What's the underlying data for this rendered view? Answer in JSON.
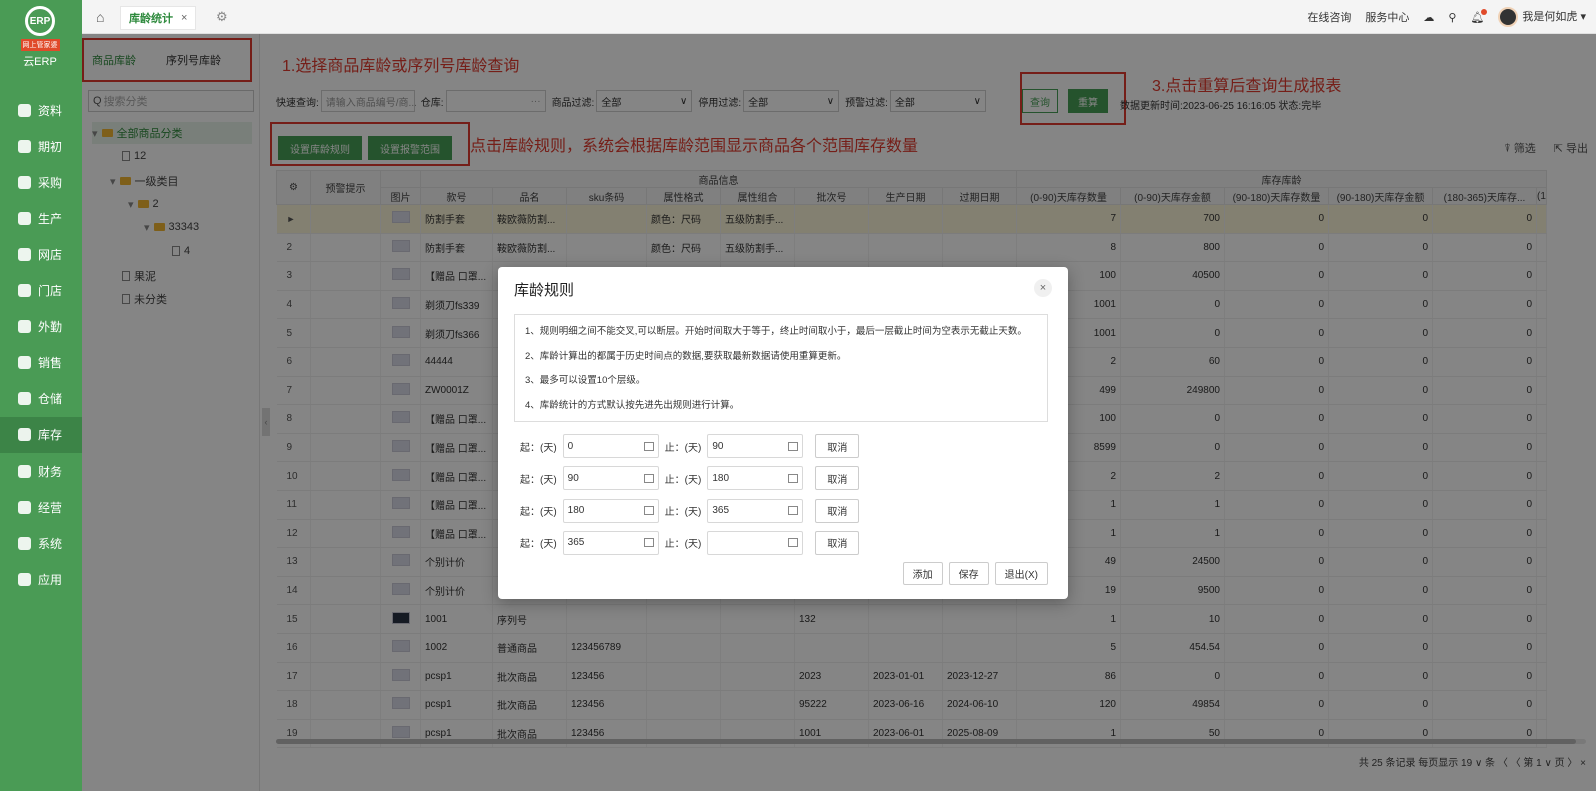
{
  "sidebar": {
    "logo": {
      "tag": "网上管家婆",
      "name": "云ERP"
    },
    "items": [
      {
        "label": "资料",
        "icon": "folder-icon"
      },
      {
        "label": "期初",
        "icon": "clock-icon"
      },
      {
        "label": "采购",
        "icon": "cart-icon"
      },
      {
        "label": "生产",
        "icon": "factory-icon"
      },
      {
        "label": "网店",
        "icon": "shop-icon"
      },
      {
        "label": "门店",
        "icon": "store-icon"
      },
      {
        "label": "外勤",
        "icon": "location-icon"
      },
      {
        "label": "销售",
        "icon": "sales-icon"
      },
      {
        "label": "仓储",
        "icon": "warehouse-icon"
      },
      {
        "label": "库存",
        "icon": "inventory-icon"
      },
      {
        "label": "财务",
        "icon": "finance-icon"
      },
      {
        "label": "经营",
        "icon": "chart-icon"
      },
      {
        "label": "系统",
        "icon": "gear-icon"
      },
      {
        "label": "应用",
        "icon": "apps-icon"
      }
    ]
  },
  "topbar": {
    "tab_label": "库龄统计",
    "tab_close": "×",
    "right": {
      "consult": "在线咨询",
      "service": "服务中心",
      "user": "我是何如虎"
    }
  },
  "tree": {
    "mode_tabs": [
      "商品库龄",
      "序列号库龄"
    ],
    "search_placeholder": "搜索分类",
    "nodes": [
      "全部商品分类",
      "12",
      "一级类目",
      "2",
      "33343",
      "4",
      "果泥",
      "未分类"
    ]
  },
  "annotations": {
    "step1": "1.选择商品库龄或序列号库龄查询",
    "step2": "点击库龄规则，系统会根据库龄范围显示商品各个范围库存数量",
    "step3": "3.点击重算后查询生成报表"
  },
  "filters": {
    "quick_label": "快速查询:",
    "quick_placeholder": "请输入商品编号/商...",
    "warehouse_label": "仓库:",
    "goods_filter_label": "商品过滤:",
    "goods_filter_value": "全部",
    "disabled_filter_label": "停用过滤:",
    "disabled_filter_value": "全部",
    "warn_filter_label": "预警过滤:",
    "warn_filter_value": "全部",
    "query_btn": "查询",
    "recalc_btn": "重算",
    "status_text": "数据更新时间:2023-06-25 16:16:05 状态:完毕"
  },
  "toolbar": {
    "rule_btn": "设置库龄规则",
    "warn_btn": "设置报警范围",
    "filter_label": "筛选",
    "export_label": "导出"
  },
  "grid": {
    "group_headers": {
      "goods": "商品信息",
      "age": "库存库龄"
    },
    "columns": [
      "预警提示",
      "图片",
      "款号",
      "品名",
      "sku条码",
      "属性格式",
      "属性组合",
      "批次号",
      "生产日期",
      "过期日期",
      "(0-90)天库存数量",
      "(0-90)天库存金额",
      "(90-180)天库存数量",
      "(90-180)天库存金额",
      "(180-365)天库存...",
      "(1"
    ],
    "rows": [
      {
        "n": "►",
        "code": "防割手套",
        "name": "鞍欧薇防割...",
        "sku": "",
        "fmt": "颜色：尺码",
        "combo": "五级防割手...",
        "batch": "",
        "prod": "",
        "exp": "",
        "q1": "7",
        "a1": "700",
        "q2": "0",
        "a2": "0",
        "q3": "0"
      },
      {
        "n": "2",
        "code": "防割手套",
        "name": "鞍欧薇防割...",
        "sku": "",
        "fmt": "颜色：尺码",
        "combo": "五级防割手...",
        "batch": "",
        "prod": "",
        "exp": "",
        "q1": "8",
        "a1": "800",
        "q2": "0",
        "a2": "0",
        "q3": "0"
      },
      {
        "n": "3",
        "code": "【赠品 口罩...",
        "name": "",
        "sku": "",
        "fmt": "",
        "combo": "",
        "batch": "",
        "prod": "",
        "exp": "",
        "q1": "100",
        "a1": "40500",
        "q2": "0",
        "a2": "0",
        "q3": "0"
      },
      {
        "n": "4",
        "code": "剃须刀fs339",
        "name": "",
        "sku": "",
        "fmt": "",
        "combo": "",
        "batch": "",
        "prod": "",
        "exp": "",
        "q1": "1001",
        "a1": "0",
        "q2": "0",
        "a2": "0",
        "q3": "0"
      },
      {
        "n": "5",
        "code": "剃须刀fs366",
        "name": "",
        "sku": "",
        "fmt": "",
        "combo": "",
        "batch": "",
        "prod": "",
        "exp": "",
        "q1": "1001",
        "a1": "0",
        "q2": "0",
        "a2": "0",
        "q3": "0"
      },
      {
        "n": "6",
        "code": "44444",
        "name": "",
        "sku": "",
        "fmt": "",
        "combo": "",
        "batch": "",
        "prod": "",
        "exp": "",
        "q1": "2",
        "a1": "60",
        "q2": "0",
        "a2": "0",
        "q3": "0"
      },
      {
        "n": "7",
        "code": "ZW0001Z",
        "name": "",
        "sku": "",
        "fmt": "",
        "combo": "",
        "batch": "",
        "prod": "",
        "exp": "",
        "q1": "499",
        "a1": "249800",
        "q2": "0",
        "a2": "0",
        "q3": "0"
      },
      {
        "n": "8",
        "code": "【赠品 口罩...",
        "name": "",
        "sku": "",
        "fmt": "",
        "combo": "",
        "batch": "",
        "prod": "",
        "exp": "",
        "q1": "100",
        "a1": "0",
        "q2": "0",
        "a2": "0",
        "q3": "0"
      },
      {
        "n": "9",
        "code": "【赠品 口罩...",
        "name": "",
        "sku": "",
        "fmt": "",
        "combo": "",
        "batch": "",
        "prod": "",
        "exp": "",
        "q1": "8599",
        "a1": "0",
        "q2": "0",
        "a2": "0",
        "q3": "0"
      },
      {
        "n": "10",
        "code": "【赠品 口罩...",
        "name": "",
        "sku": "",
        "fmt": "",
        "combo": "",
        "batch": "",
        "prod": "",
        "exp": "",
        "q1": "2",
        "a1": "2",
        "q2": "0",
        "a2": "0",
        "q3": "0"
      },
      {
        "n": "11",
        "code": "【赠品 口罩...",
        "name": "",
        "sku": "",
        "fmt": "",
        "combo": "",
        "batch": "",
        "prod": "",
        "exp": "",
        "q1": "1",
        "a1": "1",
        "q2": "0",
        "a2": "0",
        "q3": "0"
      },
      {
        "n": "12",
        "code": "【赠品 口罩...",
        "name": "",
        "sku": "",
        "fmt": "",
        "combo": "",
        "batch": "",
        "prod": "",
        "exp": "",
        "q1": "1",
        "a1": "1",
        "q2": "0",
        "a2": "0",
        "q3": "0"
      },
      {
        "n": "13",
        "code": "个别计价",
        "name": "",
        "sku": "",
        "fmt": "",
        "combo": "",
        "batch": "",
        "prod": "",
        "exp": "",
        "q1": "49",
        "a1": "24500",
        "q2": "0",
        "a2": "0",
        "q3": "0"
      },
      {
        "n": "14",
        "code": "个别计价",
        "name": "",
        "sku": "",
        "fmt": "",
        "combo": "",
        "batch": "",
        "prod": "",
        "exp": "",
        "q1": "19",
        "a1": "9500",
        "q2": "0",
        "a2": "0",
        "q3": "0"
      },
      {
        "n": "15",
        "code": "1001",
        "name": "序列号",
        "sku": "",
        "fmt": "",
        "combo": "",
        "batch": "132",
        "prod": "",
        "exp": "",
        "q1": "1",
        "a1": "10",
        "q2": "0",
        "a2": "0",
        "q3": "0"
      },
      {
        "n": "16",
        "code": "1002",
        "name": "普通商品",
        "sku": "123456789",
        "fmt": "",
        "combo": "",
        "batch": "",
        "prod": "",
        "exp": "",
        "q1": "5",
        "a1": "454.54",
        "q2": "0",
        "a2": "0",
        "q3": "0"
      },
      {
        "n": "17",
        "code": "pcsp1",
        "name": "批次商品",
        "sku": "123456",
        "fmt": "",
        "combo": "",
        "batch": "2023",
        "prod": "2023-01-01",
        "exp": "2023-12-27",
        "q1": "86",
        "a1": "0",
        "q2": "0",
        "a2": "0",
        "q3": "0"
      },
      {
        "n": "18",
        "code": "pcsp1",
        "name": "批次商品",
        "sku": "123456",
        "fmt": "",
        "combo": "",
        "batch": "95222",
        "prod": "2023-06-16",
        "exp": "2024-06-10",
        "q1": "120",
        "a1": "49854",
        "q2": "0",
        "a2": "0",
        "q3": "0"
      },
      {
        "n": "19",
        "code": "pcsp1",
        "name": "批次商品",
        "sku": "123456",
        "fmt": "",
        "combo": "",
        "batch": "1001",
        "prod": "2023-06-01",
        "exp": "2025-08-09",
        "q1": "1",
        "a1": "50",
        "q2": "0",
        "a2": "0",
        "q3": "0"
      }
    ],
    "pager": "共 25 条记录 每页显示 19 ∨ 条   〈  〈  第  1 ∨ 页  〉  ×"
  },
  "modal": {
    "title": "库龄规则",
    "close": "×",
    "rules": [
      "1、规则明细之间不能交叉,可以断层。开始时间取大于等于，终止时间取小于，最后一层截止时间为空表示无截止天数。",
      "2、库龄计算出的都属于历史时间点的数据,要获取最新数据请使用重算更新。",
      "3、最多可以设置10个层级。",
      "4、库龄统计的方式默认按先进先出规则进行计算。"
    ],
    "start_label": "起：(天)",
    "end_label": "止：(天)",
    "cancel_label": "取消",
    "ranges": [
      {
        "start": "0",
        "end": "90"
      },
      {
        "start": "90",
        "end": "180"
      },
      {
        "start": "180",
        "end": "365"
      },
      {
        "start": "365",
        "end": ""
      }
    ],
    "add": "添加",
    "save": "保存",
    "exit": "退出(X)"
  }
}
